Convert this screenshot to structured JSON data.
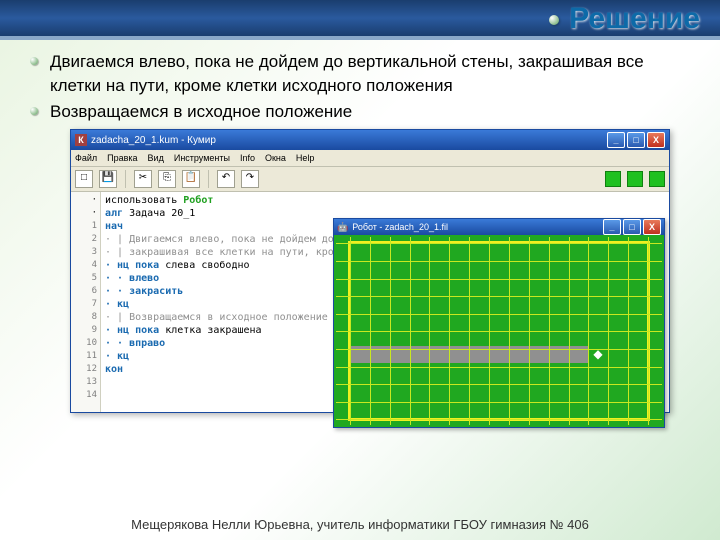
{
  "slide": {
    "title": "Решение",
    "bullet1": "Двигаемся влево, пока не дойдем до вертикальной стены, закрашивая все клетки на пути, кроме клетки исходного положения",
    "bullet2": "Возвращаемся в исходное положение",
    "footer": "Мещерякова Нелли Юрьевна, учитель информатики ГБОУ гимназия № 406"
  },
  "app": {
    "titlebar_icon": "К",
    "titlebar": "zadacha_20_1.kum - Кумир",
    "menu": [
      "Файл",
      "Правка",
      "Вид",
      "Инструменты",
      "Info",
      "Окна",
      "Help"
    ],
    "gutter": [
      "·",
      "·",
      "1",
      "2",
      "3",
      "4",
      "5",
      "6",
      "7",
      "8",
      "9",
      "10",
      "11",
      "12",
      "13",
      "14"
    ],
    "code": {
      "l1": "использовать",
      "l1_robot": "Робот",
      "l2_kw": "алг",
      "l2": "Задача 20_1",
      "l3": "нач",
      "l4": "· | Двигаемся влево, пока не дойдем до вертикальной стены,",
      "l5": "· | закрашивая все клетки на пути, кроме клетки исходного положения",
      "l6_kw": "· нц пока",
      "l6": "слева свободно",
      "l7": "· · влево",
      "l8": "· · закрасить",
      "l9": "· кц",
      "l10": "· | Возвращаемся в исходное положение",
      "l11_kw": "· нц пока",
      "l11": "клетка закрашена",
      "l12": "· · вправо",
      "l13": "· кц",
      "l14": "кон"
    }
  },
  "robot": {
    "title": "Робот - zadach_20_1.fil",
    "marker": "◆"
  },
  "win_buttons": {
    "min": "_",
    "max": "□",
    "close": "X"
  }
}
